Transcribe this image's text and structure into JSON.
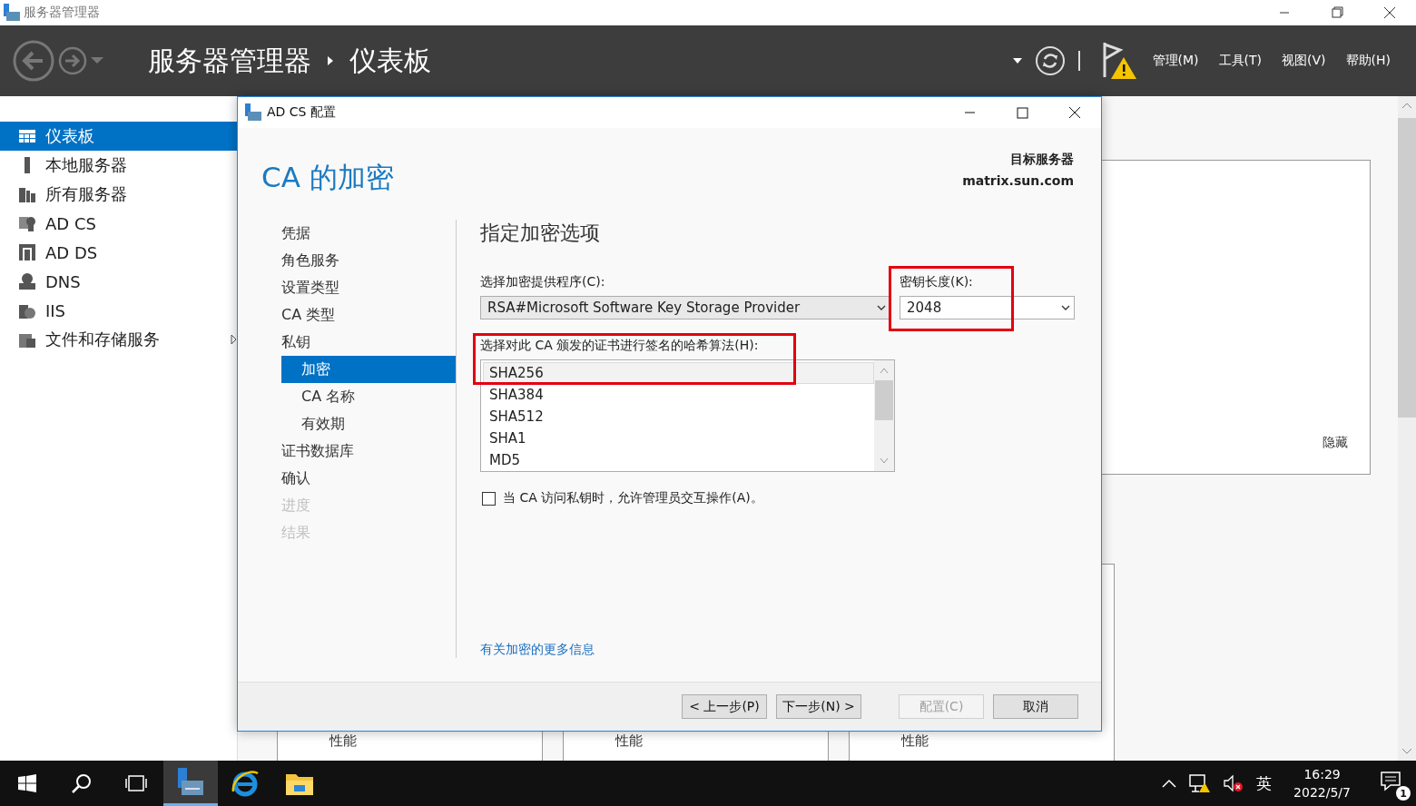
{
  "window": {
    "title": "服务器管理器"
  },
  "header": {
    "breadcrumb": [
      "服务器管理器",
      "仪表板"
    ],
    "menus": [
      "管理(M)",
      "工具(T)",
      "视图(V)",
      "帮助(H)"
    ],
    "warning": true
  },
  "sidebar": {
    "items": [
      {
        "label": "仪表板",
        "kind": "dashboard",
        "selected": true,
        "expandable": false
      },
      {
        "label": "本地服务器",
        "kind": "server",
        "selected": false,
        "expandable": false
      },
      {
        "label": "所有服务器",
        "kind": "servers",
        "selected": false,
        "expandable": false
      },
      {
        "label": "AD CS",
        "kind": "adcs",
        "selected": false,
        "expandable": false
      },
      {
        "label": "AD DS",
        "kind": "adds",
        "selected": false,
        "expandable": false
      },
      {
        "label": "DNS",
        "kind": "dns",
        "selected": false,
        "expandable": false
      },
      {
        "label": "IIS",
        "kind": "iis",
        "selected": false,
        "expandable": false
      },
      {
        "label": "文件和存储服务",
        "kind": "files",
        "selected": false,
        "expandable": true
      }
    ]
  },
  "dashboard": {
    "welcome_card": {
      "hide_link": "隐藏"
    },
    "tiles": [
      {
        "label": "性能"
      },
      {
        "label": "性能"
      },
      {
        "label": "性能"
      }
    ]
  },
  "dialog": {
    "title": "AD CS 配置",
    "page_title": "CA 的加密",
    "target_label": "目标服务器",
    "target_server": "matrix.sun.com",
    "steps": [
      {
        "label": "凭据",
        "selected": false,
        "disabled": false
      },
      {
        "label": "角色服务",
        "selected": false,
        "disabled": false
      },
      {
        "label": "设置类型",
        "selected": false,
        "disabled": false
      },
      {
        "label": "CA 类型",
        "selected": false,
        "disabled": false
      },
      {
        "label": "私钥",
        "selected": false,
        "disabled": false,
        "children": [
          {
            "label": "加密",
            "selected": true,
            "disabled": false
          },
          {
            "label": "CA 名称",
            "selected": false,
            "disabled": false
          },
          {
            "label": "有效期",
            "selected": false,
            "disabled": false
          }
        ]
      },
      {
        "label": "证书数据库",
        "selected": false,
        "disabled": false
      },
      {
        "label": "确认",
        "selected": false,
        "disabled": false
      },
      {
        "label": "进度",
        "selected": false,
        "disabled": true
      },
      {
        "label": "结果",
        "selected": false,
        "disabled": true
      }
    ],
    "section_title": "指定加密选项",
    "provider": {
      "label": "选择加密提供程序(C):",
      "value": "RSA#Microsoft Software Key Storage Provider"
    },
    "key_length": {
      "label": "密钥长度(K):",
      "value": "2048"
    },
    "hash": {
      "label": "选择对此 CA 颁发的证书进行签名的哈希算法(H):",
      "items": [
        {
          "label": "SHA256",
          "selected": true
        },
        {
          "label": "SHA384",
          "selected": false
        },
        {
          "label": "SHA512",
          "selected": false
        },
        {
          "label": "SHA1",
          "selected": false
        },
        {
          "label": "MD5",
          "selected": false
        }
      ]
    },
    "interactive_option": {
      "label": "当 CA 访问私钥时，允许管理员交互操作(A)。",
      "checked": false
    },
    "more_info_link": "有关加密的更多信息",
    "buttons": [
      {
        "label": "< 上一步(P)",
        "disabled": false
      },
      {
        "label": "下一步(N) >",
        "disabled": false
      },
      {
        "label": "配置(C)",
        "disabled": true
      },
      {
        "label": "取消",
        "disabled": false
      }
    ]
  },
  "taskbar": {
    "language": "英",
    "time": "16:29",
    "date": "2022/5/7",
    "notification_count": "1"
  }
}
